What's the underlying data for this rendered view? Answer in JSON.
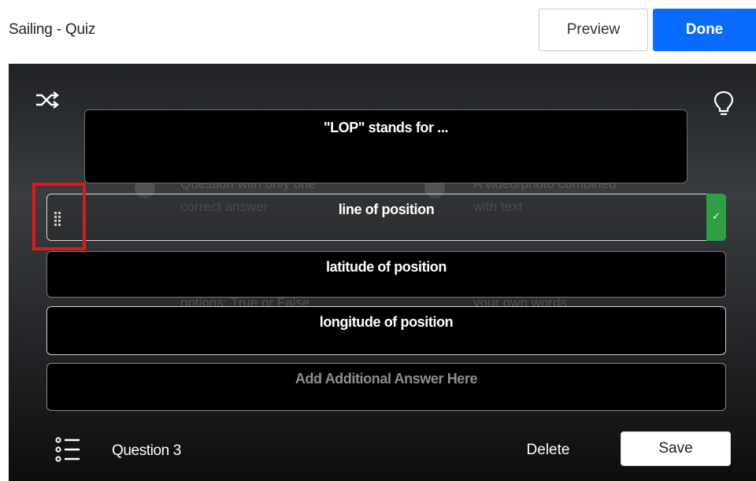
{
  "header": {
    "title": "Sailing - Quiz",
    "preview_label": "Preview",
    "done_label": "Done"
  },
  "editor": {
    "question": "\"LOP\" stands for ...",
    "answers": [
      {
        "text": "line of position",
        "correct": true
      },
      {
        "text": "latitude of position",
        "correct": false
      },
      {
        "text": "longitude of position",
        "correct": false
      }
    ],
    "add_answer_placeholder": "Add Additional Answer Here",
    "correct_mark": "✓",
    "background_hints": [
      "Question with only one",
      "correct answer",
      "A video/photo combined",
      "with text",
      "options: True or False",
      "your own words"
    ]
  },
  "footer": {
    "question_label": "Question 3",
    "delete_label": "Delete",
    "save_label": "Save"
  },
  "icons": {
    "shuffle": "shuffle-icon",
    "bulb": "lightbulb-icon",
    "drag": "drag-handle-icon",
    "list": "question-list-icon"
  },
  "colors": {
    "primary": "#0a6cff",
    "correct": "#2ea043",
    "highlight": "#e01818"
  }
}
